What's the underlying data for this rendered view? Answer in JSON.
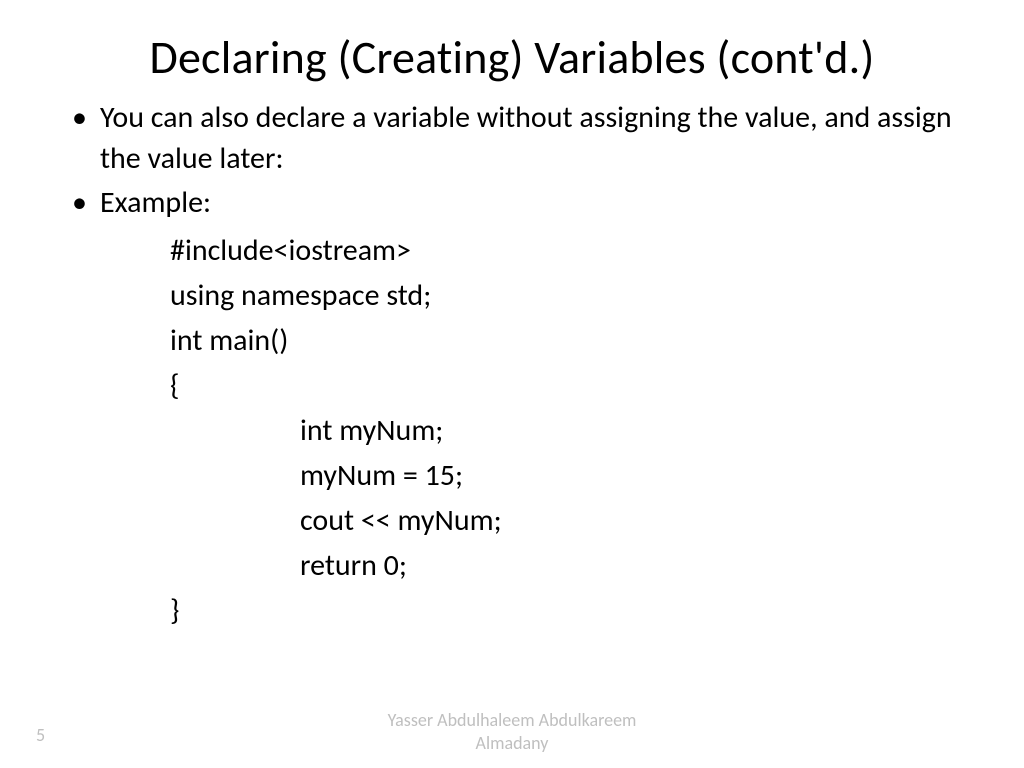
{
  "title": "Declaring (Creating) Variables (cont'd.)",
  "bullets": {
    "b1": "You can also declare a variable without assigning the value, and assign the value later:",
    "b2": "Example:"
  },
  "code": {
    "l1": "#include<iostream>",
    "l2": "using namespace std;",
    "l3": "int main()",
    "l4": "{",
    "l5": "int myNum;",
    "l6": "myNum = 15;",
    "l7": "cout << myNum;",
    "l8": "return 0;",
    "l9": "}"
  },
  "footer": {
    "line1": "Yasser Abdulhaleem Abdulkareem",
    "line2": "Almadany"
  },
  "page": "5"
}
